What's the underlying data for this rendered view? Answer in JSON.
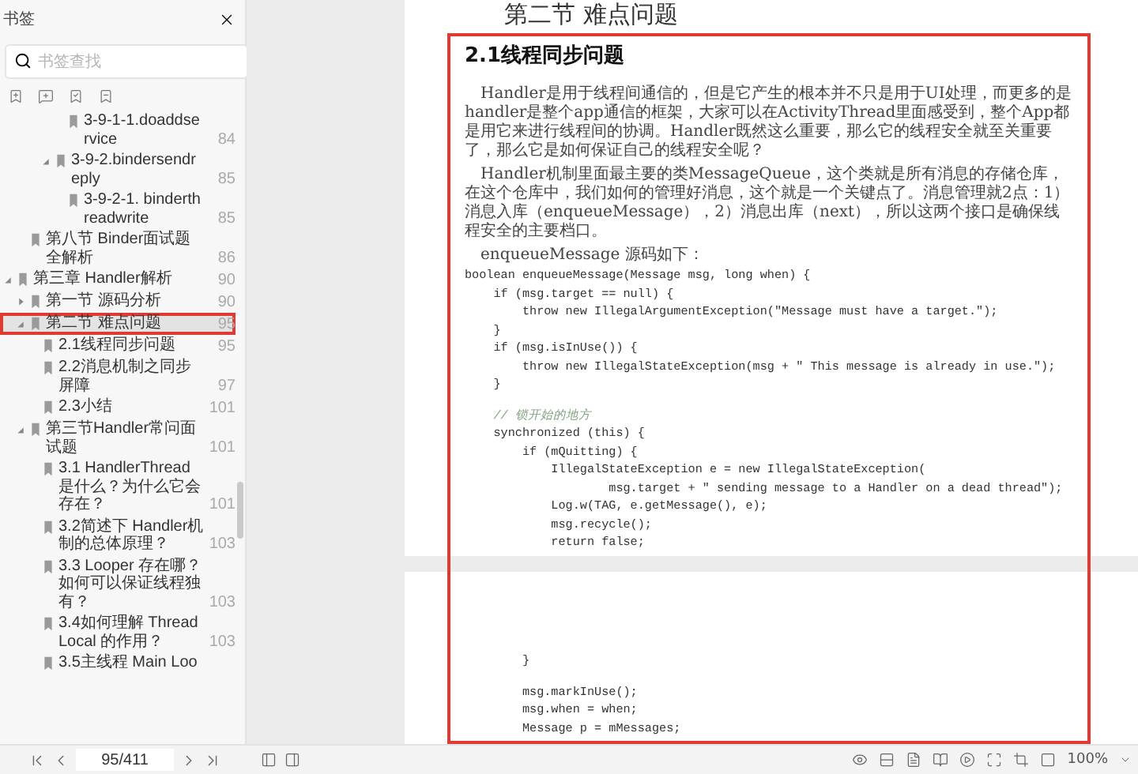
{
  "sidebar": {
    "title": "书签",
    "search": {
      "placeholder": "书签查找"
    },
    "tree": [
      {
        "children": [
          {
            "children": [
              {
                "children": [
                  {
                    "children": [
                      {
                        "label": "3-9-1-1.doaddservice",
                        "page": "84",
                        "selected": false,
                        "highlighted": false
                      }
                    ]
                  },
                  {
                    "label": "3-9-2.bindersendreply",
                    "page": "85",
                    "expanded": true,
                    "selected": false,
                    "highlighted": false,
                    "children": [
                      {
                        "label": "3-9-2-1. binderthreadwrite",
                        "page": "85",
                        "selected": false,
                        "highlighted": false
                      }
                    ]
                  }
                ]
              }
            ]
          },
          {
            "label": "第八节 Binder面试题全解析",
            "page": "86",
            "selected": false,
            "highlighted": false
          }
        ]
      },
      {
        "label": "第三章 Handler解析",
        "page": "90",
        "expanded": true,
        "selected": false,
        "highlighted": false,
        "children": [
          {
            "label": "第一节 源码分析",
            "page": "90",
            "expanded": false,
            "selected": false,
            "highlighted": false
          },
          {
            "label": "第二节 难点问题",
            "page": "95",
            "expanded": true,
            "selected": true,
            "highlighted": true,
            "children": [
              {
                "label": "2.1线程同步问题",
                "page": "95",
                "selected": false,
                "highlighted": false
              },
              {
                "label": "2.2消息机制之同步屏障",
                "page": "97",
                "selected": false,
                "highlighted": false
              },
              {
                "label": "2.3小结",
                "page": "101",
                "selected": false,
                "highlighted": false
              }
            ]
          },
          {
            "label": "第三节Handler常问面试题",
            "page": "101",
            "expanded": true,
            "selected": false,
            "highlighted": false,
            "children": [
              {
                "label": "3.1 HandlerThread是什么？为什么它会存在？",
                "page": "101",
                "selected": false,
                "highlighted": false
              },
              {
                "label": "3.2简述下 Handler机制的总体原理？",
                "page": "103",
                "selected": false,
                "highlighted": false
              },
              {
                "label": "3.3 Looper 存在哪？如何可以保证线程独有？",
                "page": "103",
                "selected": false,
                "highlighted": false
              },
              {
                "label": "3.4如何理解 ThreadLocal 的作用？",
                "page": "103",
                "selected": false,
                "highlighted": false
              },
              {
                "label": "3.5主线程 Main Loo",
                "selected": false,
                "highlighted": false
              }
            ]
          }
        ]
      }
    ]
  },
  "document": {
    "highlighted": true,
    "pages": [
      {
        "chapter_heading": "第二节  难点问题",
        "section_heading": "2.1线程同步问题",
        "paragraphs": [
          "Handler是用于线程间通信的，但是它产生的根本并不只是用于UI处理，而更多的是handler是整个app通信的框架，大家可以在ActivityThread里面感受到，整个App都是用它来进行线程间的协调。Handler既然这么重要，那么它的线程安全就至关重要了，那么它是如何保证自己的线程安全呢？",
          "Handler机制里面最主要的类MessageQueue，这个类就是所有消息的存储仓库，在这个仓库中，我们如何的管理好消息，这个就是一个关键点了。消息管理就2点：1）消息入库（enqueueMessage），2）消息出库（next），所以这两个接口是确保线程安全的主要档口。",
          "enqueueMessage 源码如下："
        ],
        "code": [
          {
            "kind": "code",
            "text": "boolean enqueueMessage(Message msg, long when) {"
          },
          {
            "kind": "code",
            "text": "    if (msg.target == null) {"
          },
          {
            "kind": "code",
            "text": "        throw new IllegalArgumentException(\"Message must have a target.\");"
          },
          {
            "kind": "code",
            "text": "    }"
          },
          {
            "kind": "code",
            "text": "    if (msg.isInUse()) {"
          },
          {
            "kind": "code",
            "text": "        throw new IllegalStateException(msg + \" This message is already in use.\");"
          },
          {
            "kind": "code",
            "text": "    }"
          },
          {
            "kind": "comment",
            "text": "    // 锁开始的地方"
          },
          {
            "kind": "code",
            "text": "    synchronized (this) {"
          },
          {
            "kind": "code",
            "text": "        if (mQuitting) {"
          },
          {
            "kind": "code",
            "text": "            IllegalStateException e = new IllegalStateException("
          },
          {
            "kind": "code",
            "text": "                    msg.target + \" sending message to a Handler on a dead thread\");"
          },
          {
            "kind": "code",
            "text": "            Log.w(TAG, e.getMessage(), e);"
          },
          {
            "kind": "code",
            "text": "            msg.recycle();"
          },
          {
            "kind": "code",
            "text": "            return false;"
          }
        ]
      },
      {
        "code": [
          {
            "kind": "code",
            "text": "        }"
          },
          {
            "kind": "gap",
            "text": "        msg.markInUse();"
          },
          {
            "kind": "code",
            "text": "        msg.when = when;"
          },
          {
            "kind": "code",
            "text": "        Message p = mMessages;"
          }
        ]
      }
    ]
  },
  "status_bar": {
    "page_field": "95/411",
    "zoom": "100%"
  }
}
